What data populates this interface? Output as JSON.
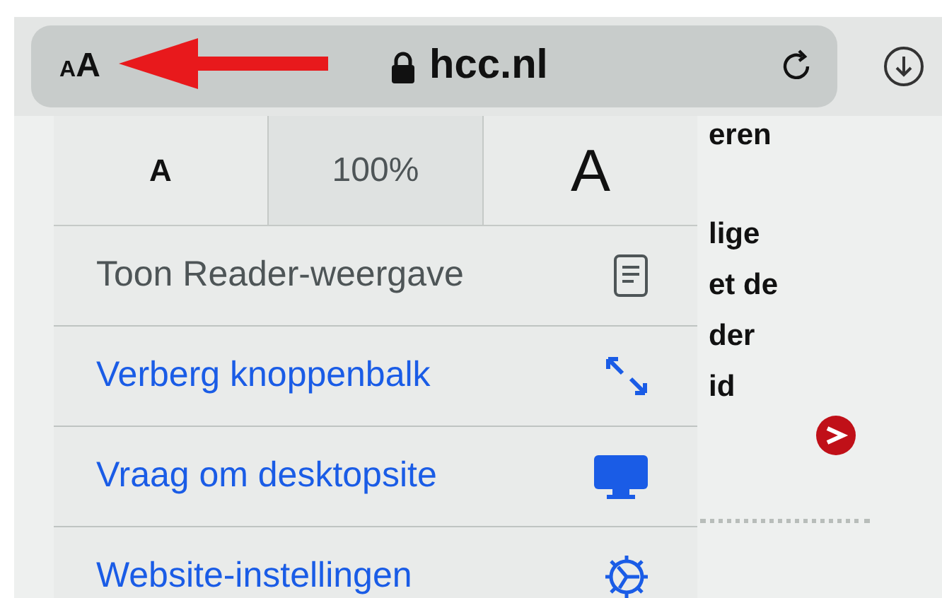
{
  "address_bar": {
    "text_size_small": "A",
    "text_size_large": "A",
    "url": "hcc.nl"
  },
  "font_size_row": {
    "decrease": "A",
    "zoom": "100%",
    "increase": "A"
  },
  "menu_items": [
    {
      "label": "Toon Reader-weergave",
      "disabled": true
    },
    {
      "label": "Verberg knoppenbalk",
      "disabled": false
    },
    {
      "label": "Vraag om desktopsite",
      "disabled": false
    },
    {
      "label": "Website-instellingen",
      "disabled": false
    }
  ],
  "page_fragments": [
    "eren",
    "lige",
    "et de",
    "der",
    "id"
  ]
}
